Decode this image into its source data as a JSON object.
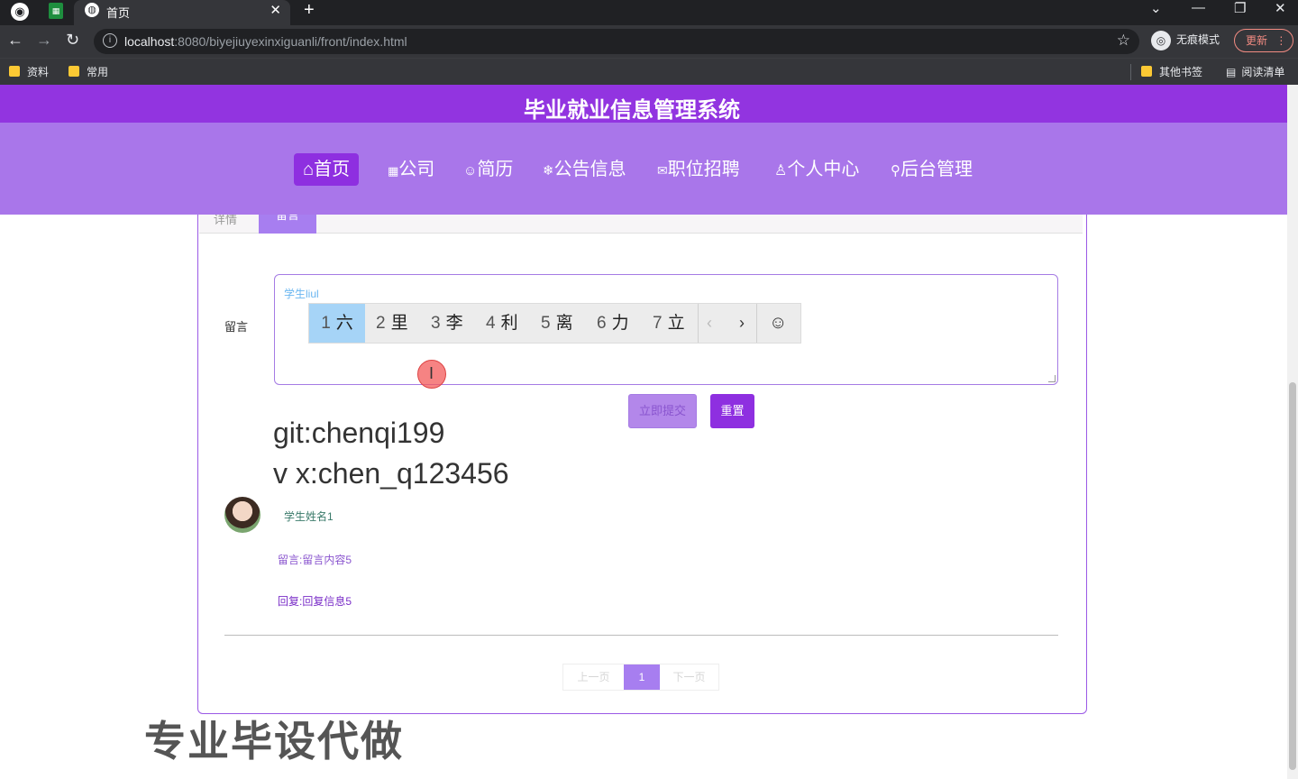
{
  "browser": {
    "tab_title": "首页",
    "new_tab": "+",
    "url_host": "localhost",
    "url_rest": ":8080/biyejiuyexinxiguanli/front/index.html",
    "incognito_label": "无痕模式",
    "update_label": "更新",
    "bookmarks": [
      "资料",
      "常用"
    ],
    "other_bookmarks": "其他书签",
    "reading_list": "阅读清单"
  },
  "site": {
    "title": "毕业就业信息管理系统",
    "nav": [
      {
        "icon": "⌂",
        "label": "首页"
      },
      {
        "icon": "▦",
        "label": "公司"
      },
      {
        "icon": "☺",
        "label": "简历"
      },
      {
        "icon": "❄",
        "label": "公告信息"
      },
      {
        "icon": "✉",
        "label": "职位招聘"
      },
      {
        "icon": "♙",
        "label": "个人中心"
      },
      {
        "icon": "⚲",
        "label": "后台管理"
      }
    ]
  },
  "detail_tabs": {
    "detail": "详情",
    "message": "留言"
  },
  "form": {
    "label": "留言",
    "typed_text": "学生liul",
    "submit_label": "立即提交",
    "reset_label": "重置"
  },
  "ime": {
    "candidates": [
      {
        "num": "1",
        "char": "六"
      },
      {
        "num": "2",
        "char": "里"
      },
      {
        "num": "3",
        "char": "李"
      },
      {
        "num": "4",
        "char": "利"
      },
      {
        "num": "5",
        "char": "离"
      },
      {
        "num": "6",
        "char": "力"
      },
      {
        "num": "7",
        "char": "立"
      }
    ],
    "prev": "‹",
    "next": "›",
    "emoji": "☺"
  },
  "overlay": {
    "line1": "git:chenqi199",
    "line2": "v x:chen_q123456"
  },
  "comment": {
    "name": "学生姓名1",
    "message": "留言:留言内容5",
    "reply": "回复:回复信息5"
  },
  "pager": {
    "prev": "上一页",
    "current": "1",
    "next": "下一页"
  },
  "watermark": "专业毕设代做"
}
